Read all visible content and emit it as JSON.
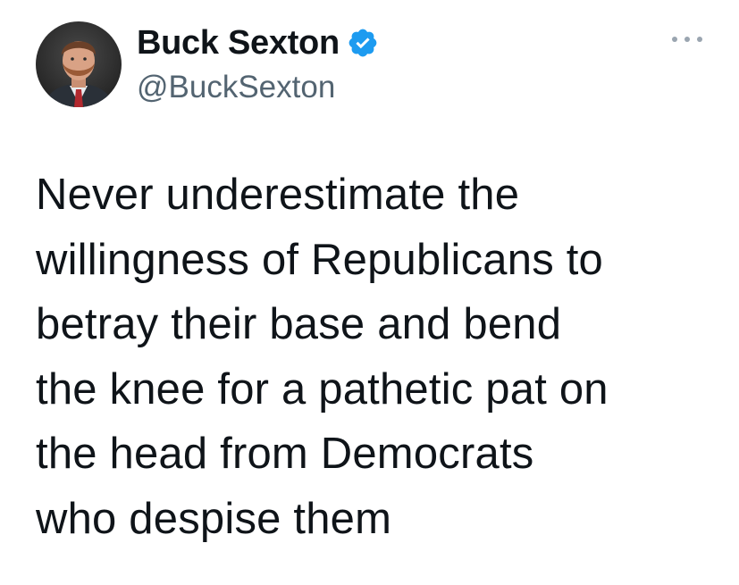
{
  "author": {
    "display_name": "Buck Sexton",
    "handle": "@BuckSexton",
    "verified": true,
    "avatar_icon": "profile-photo"
  },
  "tweet": {
    "text": "Never underestimate the\nwillingness of Republicans to\nbetray their base and bend\nthe knee for a pathetic pat on\nthe head from Democrats\nwho despise them"
  },
  "icons": {
    "verified": "verified-badge-icon",
    "more": "more-options-icon"
  },
  "colors": {
    "verified_blue": "#1d9bf0",
    "text": "#0f1419",
    "secondary_text": "#536471"
  }
}
